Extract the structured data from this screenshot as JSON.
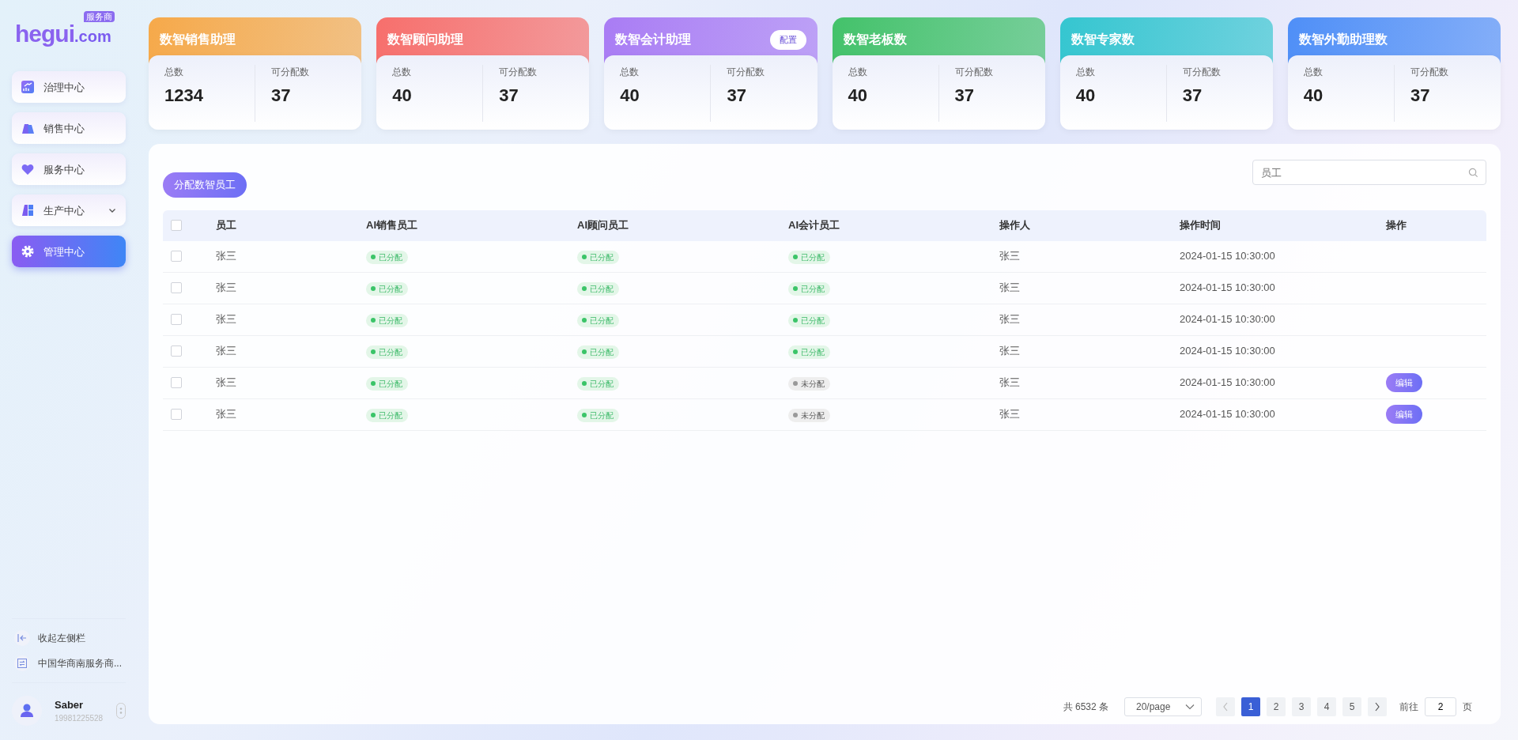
{
  "logo": {
    "text": "hegui",
    "suffix": ".com",
    "badge": "服务商"
  },
  "sidebar": {
    "items": [
      {
        "label": "治理中心",
        "kind": "link",
        "selected": false
      },
      {
        "label": "销售中心",
        "kind": "link",
        "selected": false
      },
      {
        "label": "服务中心",
        "kind": "link",
        "selected": false
      },
      {
        "label": "生产中心",
        "kind": "group",
        "selected": false
      },
      {
        "label": "管理中心",
        "kind": "link",
        "selected": true
      }
    ],
    "footer_links": [
      "收起左侧栏",
      "中国华商南服务商..."
    ],
    "user": {
      "name": "Saber",
      "phone": "19981225528"
    }
  },
  "stat_cards": [
    {
      "title": "数智销售助理",
      "color": "#f6a94a",
      "total_label": "总数",
      "total": "1234",
      "assignable_label": "可分配数",
      "assignable": "37"
    },
    {
      "title": "数智顾问助理",
      "color": "#f76f6c",
      "total_label": "总数",
      "total": "40",
      "assignable_label": "可分配数",
      "assignable": "37"
    },
    {
      "title": "数智会计助理",
      "color": "#a97cf4",
      "total_label": "总数",
      "total": "40",
      "assignable_label": "可分配数",
      "assignable": "37",
      "action": "配置"
    },
    {
      "title": "数智老板数",
      "color": "#43c26a",
      "total_label": "总数",
      "total": "40",
      "assignable_label": "可分配数",
      "assignable": "37"
    },
    {
      "title": "数智专家数",
      "color": "#35c6d0",
      "total_label": "总数",
      "total": "40",
      "assignable_label": "可分配数",
      "assignable": "37"
    },
    {
      "title": "数智外勤助理数",
      "color": "#4f8ff7",
      "total_label": "总数",
      "total": "40",
      "assignable_label": "可分配数",
      "assignable": "37"
    }
  ],
  "toolbar": {
    "assign_button": "分配数智员工",
    "search": {
      "placeholder": "员工"
    }
  },
  "table": {
    "select_all": {
      "checked": false
    },
    "columns": [
      "员工",
      "AI销售员工",
      "AI顾问员工",
      "AI会计员工",
      "操作人",
      "操作时间",
      "操作"
    ],
    "rows": [
      {
        "checked": false,
        "employee": "张三",
        "statuses": [
          {
            "label": "已分配",
            "assigned": true
          },
          {
            "label": "已分配",
            "assigned": true
          },
          {
            "label": "已分配",
            "assigned": true
          }
        ],
        "operator": "张三",
        "time": "2024-01-15 10:30:00"
      },
      {
        "checked": false,
        "employee": "张三",
        "statuses": [
          {
            "label": "已分配",
            "assigned": true
          },
          {
            "label": "已分配",
            "assigned": true
          },
          {
            "label": "已分配",
            "assigned": true
          }
        ],
        "operator": "张三",
        "time": "2024-01-15 10:30:00"
      },
      {
        "checked": false,
        "employee": "张三",
        "statuses": [
          {
            "label": "已分配",
            "assigned": true
          },
          {
            "label": "已分配",
            "assigned": true
          },
          {
            "label": "已分配",
            "assigned": true
          }
        ],
        "operator": "张三",
        "time": "2024-01-15 10:30:00"
      },
      {
        "checked": false,
        "employee": "张三",
        "statuses": [
          {
            "label": "已分配",
            "assigned": true
          },
          {
            "label": "已分配",
            "assigned": true
          },
          {
            "label": "已分配",
            "assigned": true
          }
        ],
        "operator": "张三",
        "time": "2024-01-15 10:30:00"
      },
      {
        "checked": false,
        "employee": "张三",
        "statuses": [
          {
            "label": "已分配",
            "assigned": true
          },
          {
            "label": "已分配",
            "assigned": true
          },
          {
            "label": "未分配",
            "assigned": false
          }
        ],
        "operator": "张三",
        "time": "2024-01-15 10:30:00",
        "action": "编辑"
      },
      {
        "checked": false,
        "employee": "张三",
        "statuses": [
          {
            "label": "已分配",
            "assigned": true
          },
          {
            "label": "已分配",
            "assigned": true
          },
          {
            "label": "未分配",
            "assigned": false
          }
        ],
        "operator": "张三",
        "time": "2024-01-15 10:30:00",
        "action": "编辑"
      }
    ]
  },
  "pagination": {
    "total": "共 6532 条",
    "page_size": "20/page",
    "pages": [
      {
        "label": "1",
        "selected": true
      },
      {
        "label": "2",
        "selected": false
      },
      {
        "label": "3",
        "selected": false
      },
      {
        "label": "4",
        "selected": false
      },
      {
        "label": "5",
        "selected": false
      }
    ],
    "goto_label": "前往",
    "goto_value": "2",
    "goto_suffix": "页"
  }
}
